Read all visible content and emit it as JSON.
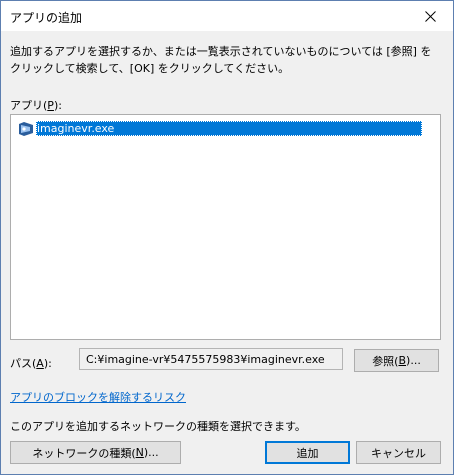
{
  "window": {
    "title": "アプリの追加"
  },
  "instruction": "追加するアプリを選択するか、または一覧表示されていないものについては [参照] をクリックして検索して、[OK] をクリックしてください。",
  "apps": {
    "label_prefix": "アプリ(",
    "label_key": "P",
    "label_suffix": "):",
    "items": [
      {
        "name": "imaginevr.exe",
        "icon": "vr-app-icon",
        "selected": true
      }
    ]
  },
  "path": {
    "label_prefix": "パス(",
    "label_key": "A",
    "label_suffix": "):",
    "value": "C:¥imagine-vr¥5475575983¥imaginevr.exe"
  },
  "browse_button": {
    "prefix": "参照(",
    "key": "B",
    "suffix": ")..."
  },
  "risk_link": "アプリのブロックを解除するリスク",
  "network_info": "このアプリを追加するネットワークの種類を選択できます。",
  "network_button": {
    "prefix": "ネットワークの種類(",
    "key": "N",
    "suffix": ")..."
  },
  "add_button": "追加",
  "cancel_button": "キャンセル",
  "colors": {
    "selection": "#0078d7",
    "link": "#0066cc",
    "dialog_bg": "#f0f0f0",
    "default_button_border": "#0078d7"
  }
}
